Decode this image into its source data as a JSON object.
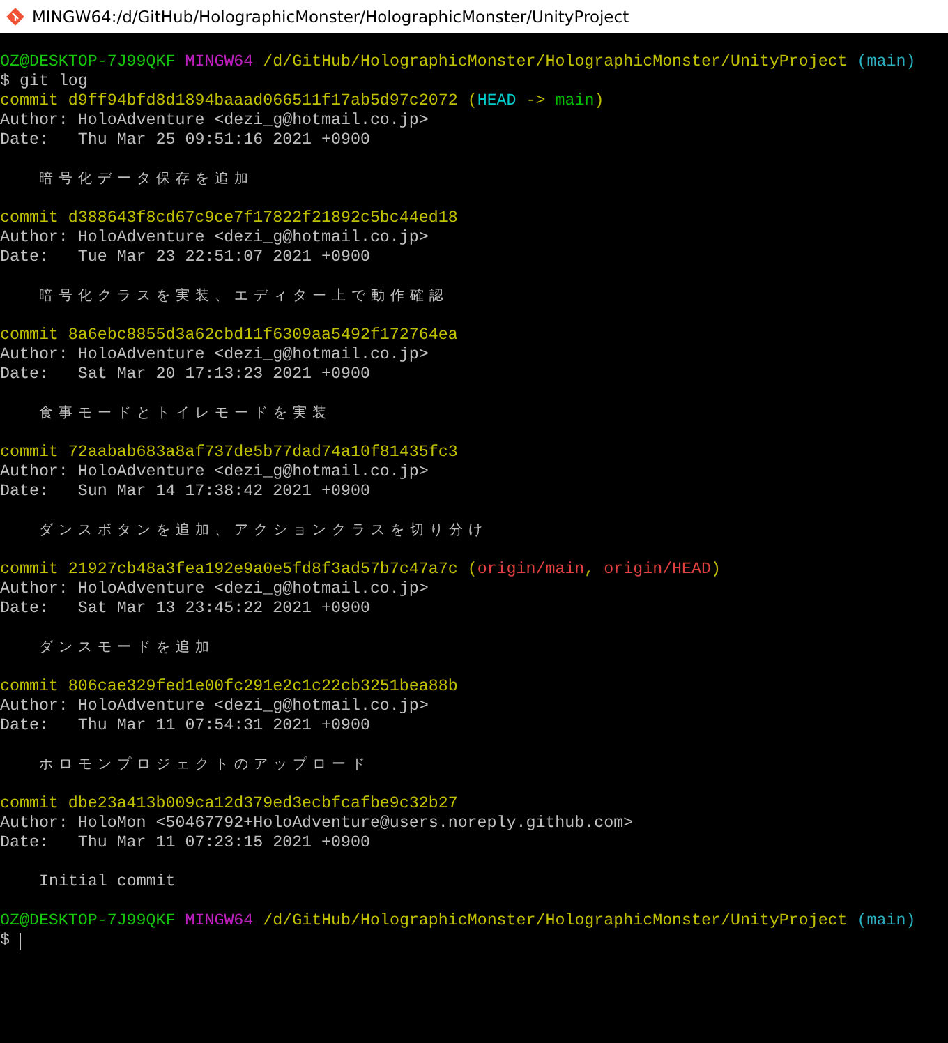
{
  "window": {
    "title": "MINGW64:/d/GitHub/HolographicMonster/HolographicMonster/UnityProject"
  },
  "prompt": {
    "user_host": "OZ@DESKTOP-7J99QKF",
    "system": "MINGW64",
    "path": "/d/GitHub/HolographicMonster/HolographicMonster/UnityProject",
    "branch": "(main)"
  },
  "command": {
    "symbol": "$",
    "text": "git log"
  },
  "commits": [
    {
      "hash": "commit d9ff94bfd8d1894baaad066511f17ab5d97c2072",
      "decoration": [
        {
          "text": "(",
          "kind": "punct"
        },
        {
          "text": "HEAD",
          "kind": "head"
        },
        {
          "text": " -> ",
          "kind": "punct"
        },
        {
          "text": "main",
          "kind": "branch"
        },
        {
          "text": ")",
          "kind": "punct"
        }
      ],
      "author": "Author: HoloAdventure <dezi_g@hotmail.co.jp>",
      "date": "Date:   Thu Mar 25 09:51:16 2021 +0900",
      "message": "暗号化データ保存を追加"
    },
    {
      "hash": "commit d388643f8cd67c9ce7f17822f21892c5bc44ed18",
      "author": "Author: HoloAdventure <dezi_g@hotmail.co.jp>",
      "date": "Date:   Tue Mar 23 22:51:07 2021 +0900",
      "message": "暗号化クラスを実装、エディター上で動作確認"
    },
    {
      "hash": "commit 8a6ebc8855d3a62cbd11f6309aa5492f172764ea",
      "author": "Author: HoloAdventure <dezi_g@hotmail.co.jp>",
      "date": "Date:   Sat Mar 20 17:13:23 2021 +0900",
      "message": "食事モードとトイレモードを実装"
    },
    {
      "hash": "commit 72aabab683a8af737de5b77dad74a10f81435fc3",
      "author": "Author: HoloAdventure <dezi_g@hotmail.co.jp>",
      "date": "Date:   Sun Mar 14 17:38:42 2021 +0900",
      "message": "ダンスボタンを追加、アクションクラスを切り分け"
    },
    {
      "hash": "commit 21927cb48a3fea192e9a0e5fd8f3ad57b7c47a7c",
      "decoration": [
        {
          "text": "(",
          "kind": "punct"
        },
        {
          "text": "origin/main",
          "kind": "remote"
        },
        {
          "text": ", ",
          "kind": "punct"
        },
        {
          "text": "origin/HEAD",
          "kind": "remote"
        },
        {
          "text": ")",
          "kind": "punct"
        }
      ],
      "author": "Author: HoloAdventure <dezi_g@hotmail.co.jp>",
      "date": "Date:   Sat Mar 13 23:45:22 2021 +0900",
      "message": "ダンスモードを追加"
    },
    {
      "hash": "commit 806cae329fed1e00fc291e2c1c22cb3251bea88b",
      "author": "Author: HoloAdventure <dezi_g@hotmail.co.jp>",
      "date": "Date:   Thu Mar 11 07:54:31 2021 +0900",
      "message": "ホロモンプロジェクトのアップロード"
    },
    {
      "hash": "commit dbe23a413b009ca12d379ed3ecbfcafbe9c32b27",
      "author": "Author: HoloMon <50467792+HoloAdventure@users.noreply.github.com>",
      "date": "Date:   Thu Mar 11 07:23:15 2021 +0900",
      "message": "Initial commit"
    }
  ],
  "final_prompt": {
    "user_host": "OZ@DESKTOP-7J99QKF",
    "system": "MINGW64",
    "path": "/d/GitHub/HolographicMonster/HolographicMonster/UnityProject",
    "branch": "(main)",
    "symbol": "$"
  }
}
